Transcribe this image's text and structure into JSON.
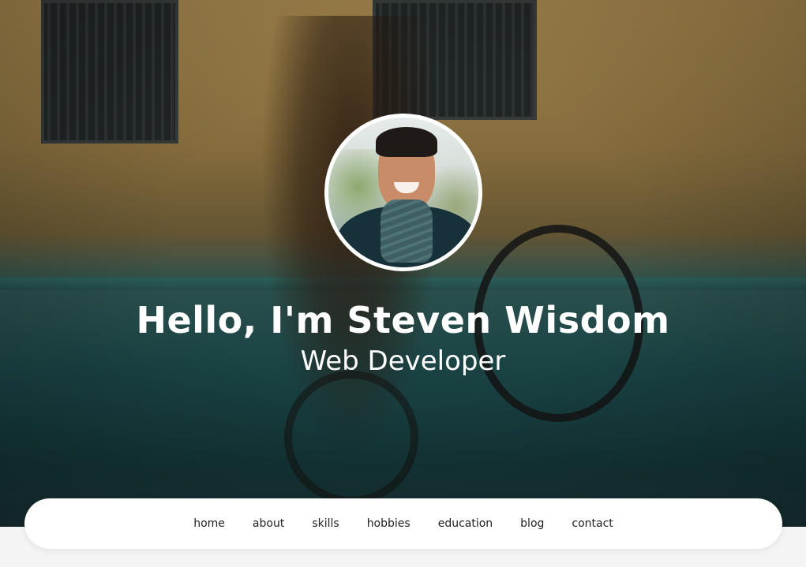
{
  "hero": {
    "headline": "Hello, I'm Steven Wisdom",
    "subheadline": "Web Developer",
    "background_image": "man-wheelie-bicycle-photo",
    "avatar_image": "smiling-man-profile-photo"
  },
  "nav": {
    "items": [
      {
        "label": "home"
      },
      {
        "label": "about"
      },
      {
        "label": "skills"
      },
      {
        "label": "hobbies"
      },
      {
        "label": "education"
      },
      {
        "label": "blog"
      },
      {
        "label": "contact"
      }
    ]
  },
  "colors": {
    "nav_background": "#ffffff",
    "page_background": "#f4f4f5",
    "headline_text": "#ffffff",
    "nav_text": "#222222"
  }
}
